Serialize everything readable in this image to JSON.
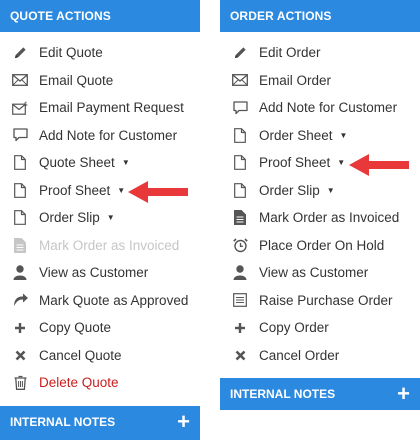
{
  "quote_actions": {
    "title": "QUOTE ACTIONS",
    "items": [
      {
        "label": "Edit Quote",
        "icon": "pencil-icon"
      },
      {
        "label": "Email Quote",
        "icon": "envelope-icon"
      },
      {
        "label": "Email Payment Request",
        "icon": "envelope-dollar-icon"
      },
      {
        "label": "Add Note for Customer",
        "icon": "speech-bubble-icon"
      },
      {
        "label": "Quote Sheet",
        "icon": "document-icon",
        "caret": "▼"
      },
      {
        "label": "Proof Sheet",
        "icon": "document-icon",
        "caret": "▼"
      },
      {
        "label": "Order Slip",
        "icon": "document-icon",
        "caret": "▼"
      },
      {
        "label": "Mark Order as Invoiced",
        "icon": "document-lines-icon",
        "disabled": true
      },
      {
        "label": "View as Customer",
        "icon": "person-icon"
      },
      {
        "label": "Mark Quote as Approved",
        "icon": "redo-arrow-icon"
      },
      {
        "label": "Copy Quote",
        "icon": "plus-icon"
      },
      {
        "label": "Cancel Quote",
        "icon": "x-icon"
      },
      {
        "label": "Delete Quote",
        "icon": "trash-icon",
        "danger": true
      }
    ]
  },
  "order_actions": {
    "title": "ORDER ACTIONS",
    "items": [
      {
        "label": "Edit Order",
        "icon": "pencil-icon"
      },
      {
        "label": "Email Order",
        "icon": "envelope-icon"
      },
      {
        "label": "Add Note for Customer",
        "icon": "speech-bubble-icon"
      },
      {
        "label": "Order Sheet",
        "icon": "document-icon",
        "caret": "▼"
      },
      {
        "label": "Proof Sheet",
        "icon": "document-icon",
        "caret": "▼"
      },
      {
        "label": "Order Slip",
        "icon": "document-icon",
        "caret": "▼"
      },
      {
        "label": "Mark Order as Invoiced",
        "icon": "document-lines-icon"
      },
      {
        "label": "Place Order On Hold",
        "icon": "alarm-clock-icon"
      },
      {
        "label": "View as Customer",
        "icon": "person-icon"
      },
      {
        "label": "Raise Purchase Order",
        "icon": "list-doc-icon"
      },
      {
        "label": "Copy Order",
        "icon": "plus-icon"
      },
      {
        "label": "Cancel Order",
        "icon": "x-icon"
      }
    ]
  },
  "internal_notes": {
    "title": "INTERNAL NOTES",
    "add_symbol": "+"
  },
  "colors": {
    "header_bg": "#2b89e0",
    "arrow": "#e8383a",
    "danger": "#cc1e1e",
    "disabled": "#c6c6c6"
  }
}
